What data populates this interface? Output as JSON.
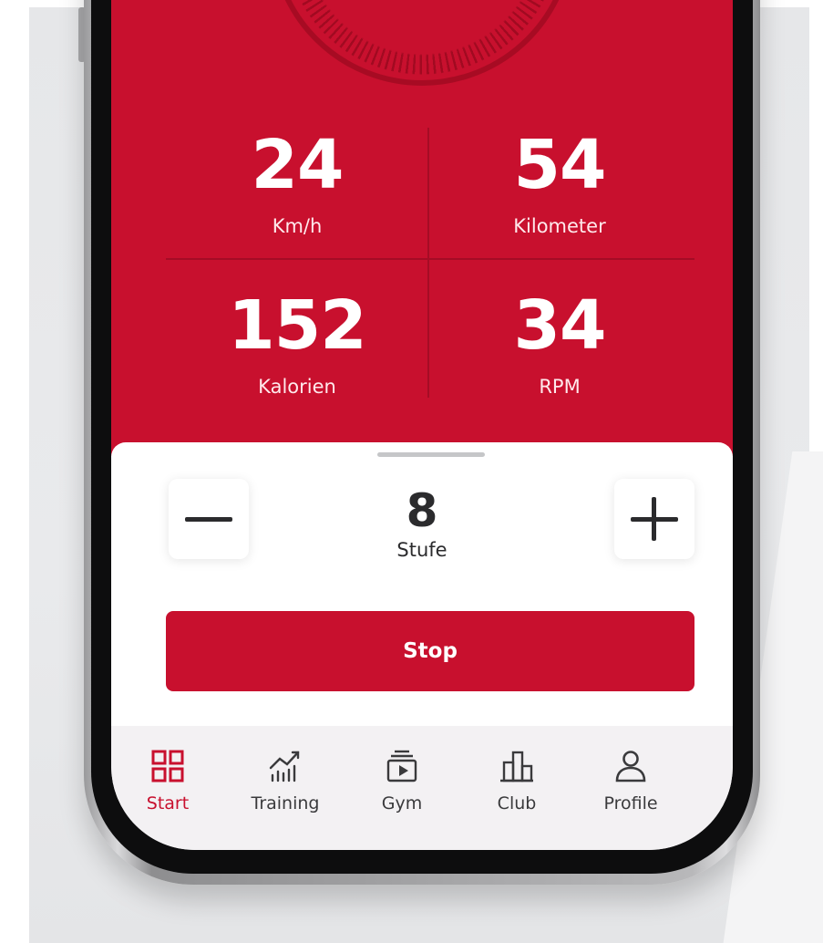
{
  "stats": [
    {
      "value": "24",
      "label": "Km/h"
    },
    {
      "value": "54",
      "label": "Kilometer"
    },
    {
      "value": "152",
      "label": "Kalorien"
    },
    {
      "value": "34",
      "label": "RPM"
    }
  ],
  "level": {
    "value": "8",
    "label": "Stufe"
  },
  "actions": {
    "stop_label": "Stop"
  },
  "tabbar": {
    "items": [
      {
        "label": "Start",
        "icon": "grid-icon",
        "active": true
      },
      {
        "label": "Training",
        "icon": "chart-trend-icon",
        "active": false
      },
      {
        "label": "Gym",
        "icon": "video-play-icon",
        "active": false
      },
      {
        "label": "Club",
        "icon": "buildings-icon",
        "active": false
      },
      {
        "label": "Profile",
        "icon": "person-icon",
        "active": false
      }
    ]
  },
  "colors": {
    "brand_red": "#c8102e",
    "tab_bg": "#f3f1f3",
    "text_dark": "#2b2b2d"
  }
}
